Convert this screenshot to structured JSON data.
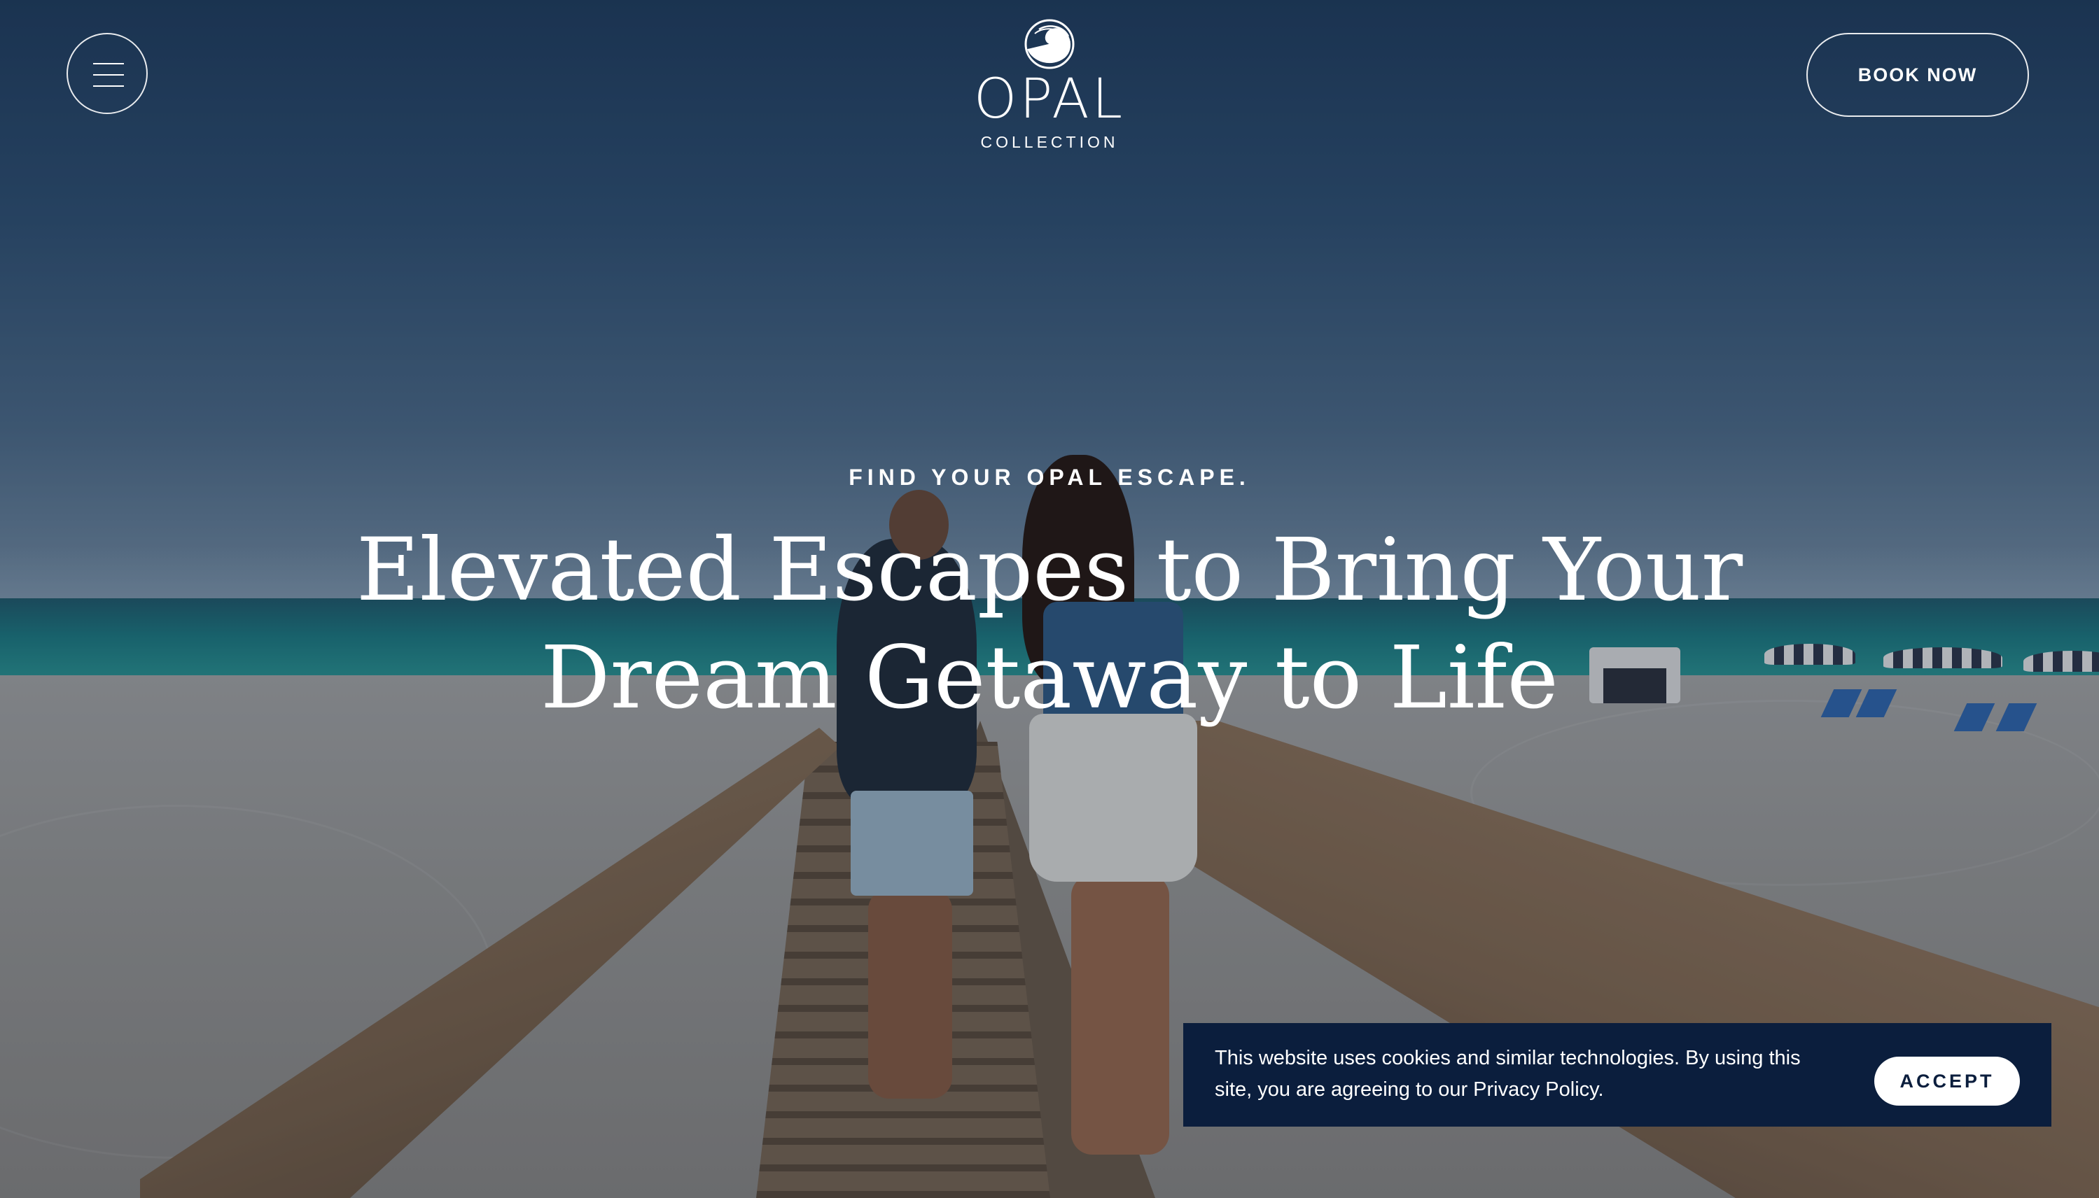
{
  "header": {
    "menu_icon": "hamburger-menu-icon",
    "logo": {
      "mark_icon": "opal-wave-icon",
      "wordmark": "OPAL",
      "subtitle": "COLLECTION"
    },
    "book_now_label": "BOOK NOW"
  },
  "hero": {
    "eyebrow": "FIND YOUR OPAL ESCAPE.",
    "headline_line1": "Elevated Escapes to Bring Your",
    "headline_line2": "Dream Getaway to Life"
  },
  "cookie_banner": {
    "message": "This website uses cookies and similar technologies. By using this site, you are agreeing to our Privacy Policy.",
    "accept_label": "ACCEPT"
  },
  "colors": {
    "banner_background": "#0b1e3d",
    "text_light": "#ffffff"
  }
}
